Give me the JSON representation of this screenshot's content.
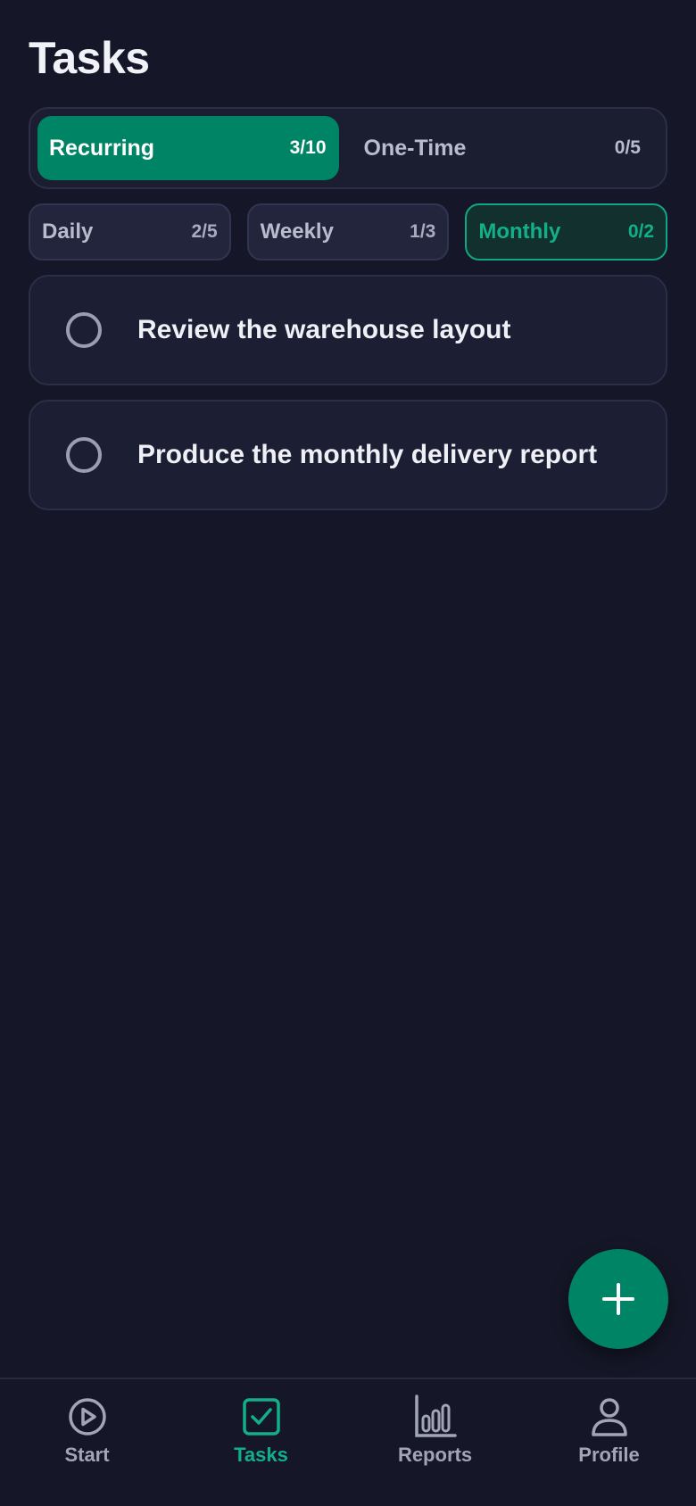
{
  "header": {
    "title": "Tasks"
  },
  "segment": {
    "recurring": {
      "label": "Recurring",
      "count": "3/10",
      "active": true
    },
    "one_time": {
      "label": "One-Time",
      "count": "0/5",
      "active": false
    }
  },
  "filters": [
    {
      "label": "Daily",
      "count": "2/5",
      "active": false
    },
    {
      "label": "Weekly",
      "count": "1/3",
      "active": false
    },
    {
      "label": "Monthly",
      "count": "0/2",
      "active": true
    }
  ],
  "tasks": [
    {
      "title": "Review the warehouse layout",
      "done": false
    },
    {
      "title": "Produce the monthly delivery report",
      "done": false
    }
  ],
  "fab": {
    "icon": "plus-icon"
  },
  "nav": [
    {
      "label": "Start",
      "icon": "play-circle-icon",
      "active": false
    },
    {
      "label": "Tasks",
      "icon": "checkbox-icon",
      "active": true
    },
    {
      "label": "Reports",
      "icon": "bar-chart-icon",
      "active": false
    },
    {
      "label": "Profile",
      "icon": "person-icon",
      "active": false
    }
  ],
  "colors": {
    "background": "#151728",
    "accent": "#008466",
    "accent_text": "#12b089",
    "card": "#1c1e33",
    "muted_text": "#a2a5b8"
  }
}
